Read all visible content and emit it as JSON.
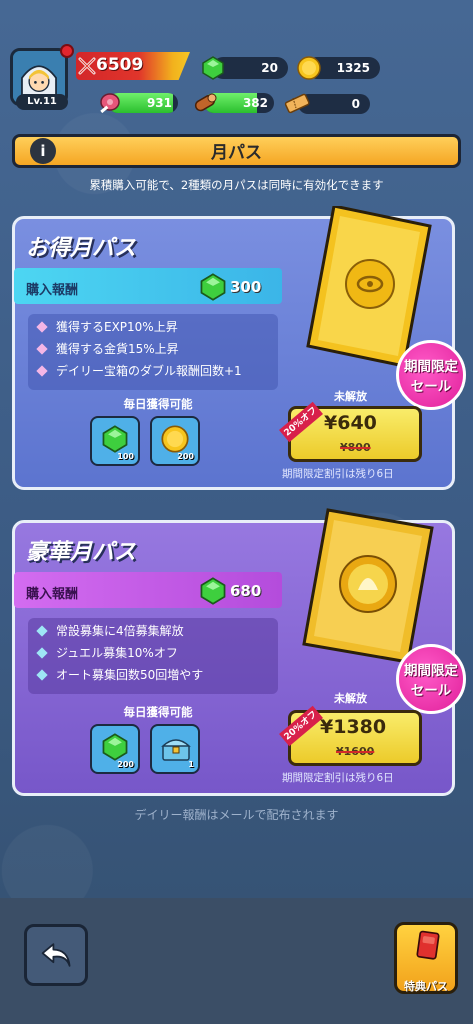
{
  "player": {
    "level": "Lv.11",
    "power": "6509"
  },
  "resources": {
    "gems": "20",
    "coins": "1325",
    "meat": "931",
    "wood": "382",
    "tickets": "0"
  },
  "resource_bars": {
    "meat_fill": 0.93,
    "wood_fill": 0.76
  },
  "header": {
    "title": "月パス",
    "subtitle": "累積購入可能で、2種類の月パスは同時に有効化できます"
  },
  "passes": [
    {
      "title": "お得月パス",
      "reward_label": "購入報酬",
      "reward_value": "300",
      "benefits": [
        "獲得するEXP10%上昇",
        "獲得する金貨15%上昇",
        "デイリー宝箱のダブル報酬回数+1"
      ],
      "daily_label": "毎日獲得可能",
      "daily_items": [
        {
          "icon": "gem-icon",
          "count": "100"
        },
        {
          "icon": "coin-icon",
          "count": "200"
        }
      ],
      "status": "未解放",
      "discount": "20%オフ",
      "price": "¥640",
      "old_price": "¥800",
      "time_left": "期間限定割引は残り6日",
      "sale_line1": "期間限定",
      "sale_line2": "セール"
    },
    {
      "title": "豪華月パス",
      "reward_label": "購入報酬",
      "reward_value": "680",
      "benefits": [
        "常設募集に4倍募集解放",
        "ジュエル募集10%オフ",
        "オート募集回数50回増やす"
      ],
      "daily_label": "毎日獲得可能",
      "daily_items": [
        {
          "icon": "gem-icon",
          "count": "200"
        },
        {
          "icon": "treasure-chest-icon",
          "count": "1"
        }
      ],
      "status": "未解放",
      "discount": "20%オフ",
      "price": "¥1380",
      "old_price": "¥1600",
      "time_left": "期間限定割引は残り6日",
      "sale_line1": "期間限定",
      "sale_line2": "セール"
    }
  ],
  "footer": {
    "note": "デイリー報酬はメールで配布されます",
    "bonus_pass_label": "特典パス"
  },
  "colors": {
    "background": "#3d5d86",
    "card_blue": "#6a80d8",
    "card_purple": "#8566d4",
    "price_yellow": "#f2dc4a",
    "sale_pink": "#e0209a",
    "gem_green": "#36c23a",
    "coin_gold": "#f6c21c"
  }
}
